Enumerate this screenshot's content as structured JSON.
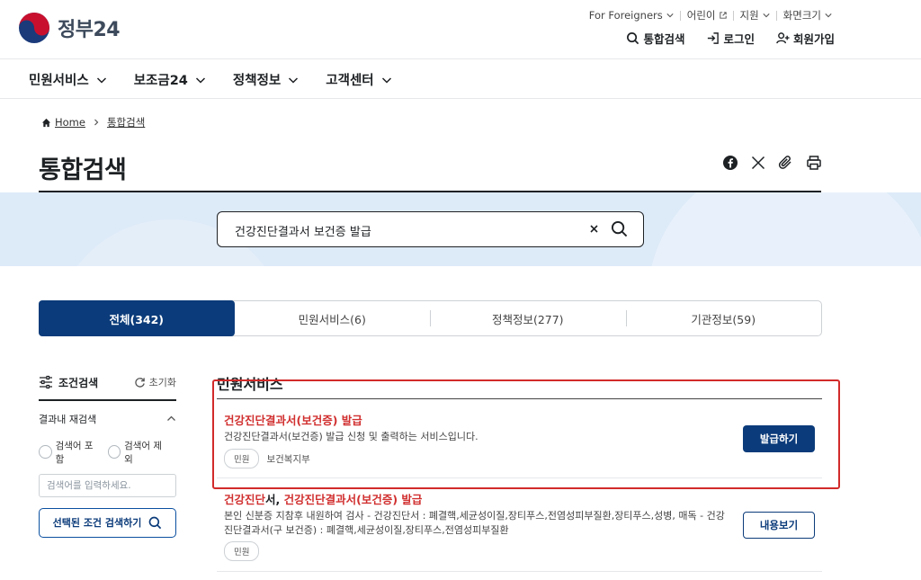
{
  "brand": {
    "name": "정부24"
  },
  "utility": {
    "top": [
      {
        "label": "For Foreigners"
      },
      {
        "label": "어린이"
      },
      {
        "label": "지원"
      },
      {
        "label": "화면크기"
      }
    ],
    "main": [
      {
        "label": "통합검색",
        "icon": "search-icon"
      },
      {
        "label": "로그인",
        "icon": "login-icon"
      },
      {
        "label": "회원가입",
        "icon": "user-plus-icon"
      }
    ]
  },
  "gnb": [
    {
      "label": "민원서비스"
    },
    {
      "label": "보조금24"
    },
    {
      "label": "정책정보"
    },
    {
      "label": "고객센터"
    }
  ],
  "breadcrumb": {
    "home": "Home",
    "current": "통합검색"
  },
  "page": {
    "title": "통합검색"
  },
  "search": {
    "query": "건강진단결과서 보건증 발급"
  },
  "tabs": [
    {
      "label": "전체(342)",
      "active": true
    },
    {
      "label": "민원서비스(6)"
    },
    {
      "label": "정책정보(277)"
    },
    {
      "label": "기관정보(59)"
    }
  ],
  "sidebar": {
    "title": "조건검색",
    "reset": "초기화",
    "subtitle": "결과내 재검색",
    "include": "검색어 포함",
    "exclude": "검색어 제외",
    "placeholder": "검색어를 입력하세요.",
    "button": "선택된 조건 검색하기"
  },
  "results": {
    "section_title": "민원서비스",
    "items": [
      {
        "title_hl1": "건강진단결과서(보건증) 발급",
        "title_mid": "",
        "title_hl2": "",
        "desc": "건강진단결과서(보건증) 발급 신청 및 출력하는 서비스입니다.",
        "tag": "민원",
        "agency": "보건복지부",
        "button": "발급하기"
      },
      {
        "title_hl1": "건강진단",
        "title_mid": "서, ",
        "title_hl2": "건강진단결과서(보건증) 발급",
        "desc": "본인 신분증 지참후 내원하여 검사 - 건강진단서 : 폐결핵,세균성이질,장티푸스,전염성피부질환,장티푸스,성병, 매독 - 건강진단결과서(구 보건증) : 폐결핵,세균성이질,장티푸스,전염성피부질환",
        "tag": "민원",
        "button": "내용보기"
      }
    ]
  },
  "colors": {
    "primary": "#0b3b7a",
    "highlight": "#d12f2f",
    "annotation": "#d22a2a"
  }
}
